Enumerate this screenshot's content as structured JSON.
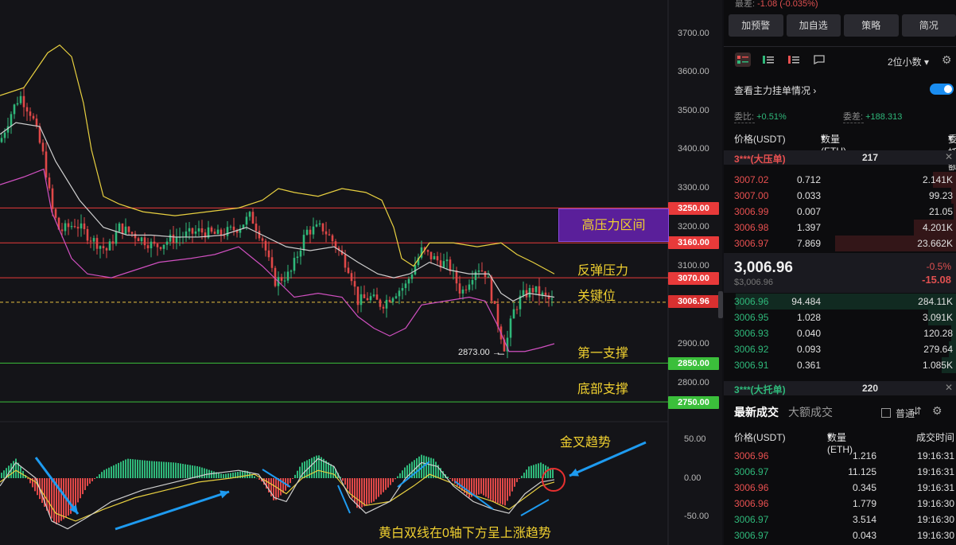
{
  "chart": {
    "price_ticks": [
      "3700.00",
      "3600.00",
      "3500.00",
      "3400.00",
      "3300.00",
      "3200.00",
      "3100.00",
      "2900.00",
      "2800.00"
    ],
    "price_levels": [
      {
        "label": "3250.00",
        "price": 3250,
        "color": "#e83a3a",
        "annotation": "高压力区间"
      },
      {
        "label": "3160.00",
        "price": 3160,
        "color": "#e83a3a",
        "annotation": ""
      },
      {
        "label": "3070.00",
        "price": 3070,
        "color": "#e83a3a",
        "annotation": "反弹压力"
      },
      {
        "label": "3006.96",
        "price": 3006.96,
        "color": "#e83a3a",
        "annotation": "关键位"
      },
      {
        "label": "2850.00",
        "price": 2850,
        "color": "#3bbf3b",
        "annotation": "第一支撑"
      },
      {
        "label": "2750.00",
        "price": 2750,
        "color": "#3bbf3b",
        "annotation": "底部支撑"
      }
    ],
    "annotations": {
      "high_pressure": "高压力区间",
      "rebound_pressure": "反弹压力",
      "key_level": "关键位",
      "first_support": "第一支撑",
      "bottom_support": "底部支撑",
      "golden_cross": "金叉趋势",
      "macd_note": "黄白双线在0轴下方呈上涨趋势"
    },
    "low_marker": "2873.00",
    "macd_ticks": [
      "50.00",
      "0.00",
      "-50.00"
    ],
    "colors": {
      "up": "#2fb87a",
      "down": "#e04848",
      "yellow": "#e8d040",
      "white": "#cfcfcf",
      "magenta": "#d050c0",
      "arrow": "#1e9bf0"
    }
  },
  "panel": {
    "top_info_label": "最差:",
    "top_info_value": "-1.08 (-0.035%)",
    "buttons": [
      "加预警",
      "加自选",
      "策略",
      "简况"
    ],
    "view_icons": [
      "orderbook-both-icon",
      "orderbook-bids-icon",
      "orderbook-asks-icon",
      "expand-icon"
    ],
    "decimals": "2位小数",
    "depth_toggle_label": "查看主力挂单情况",
    "ratio_label": "委比:",
    "ratio_value": "+0.51%",
    "diff_label": "委差:",
    "diff_value": "+188.313",
    "ob_header": {
      "price": "价格(USDT)",
      "qty": "数量 (ETH)",
      "amount": "委托额"
    },
    "big_ask": {
      "label": "3***(大压单)",
      "qty": "217"
    },
    "asks": [
      {
        "price": "3007.02",
        "qty": "0.712",
        "amount": "2.141K",
        "depth": 0.1
      },
      {
        "price": "3007.00",
        "qty": "0.033",
        "amount": "99.23",
        "depth": 0.02
      },
      {
        "price": "3006.99",
        "qty": "0.007",
        "amount": "21.05",
        "depth": 0.01
      },
      {
        "price": "3006.98",
        "qty": "1.397",
        "amount": "4.201K",
        "depth": 0.18
      },
      {
        "price": "3006.97",
        "qty": "7.869",
        "amount": "23.662K",
        "depth": 0.52
      }
    ],
    "last_price": "3,006.96",
    "last_price_usd": "$3,006.96",
    "change_pct": "-0.5%",
    "change_abs": "-15.08",
    "bids": [
      {
        "price": "3006.96",
        "qty": "94.484",
        "amount": "284.11K",
        "depth": 0.95
      },
      {
        "price": "3006.95",
        "qty": "1.028",
        "amount": "3.091K",
        "depth": 0.12
      },
      {
        "price": "3006.93",
        "qty": "0.040",
        "amount": "120.28",
        "depth": 0.02
      },
      {
        "price": "3006.92",
        "qty": "0.093",
        "amount": "279.64",
        "depth": 0.03
      },
      {
        "price": "3006.91",
        "qty": "0.361",
        "amount": "1.085K",
        "depth": 0.06
      }
    ],
    "big_bid": {
      "label": "3***(大托单)",
      "qty": "220"
    },
    "trade_tabs": [
      "最新成交",
      "大额成交"
    ],
    "common_label": "普通",
    "tr_header": {
      "price": "价格(USDT)",
      "qty": "数量(ETH)",
      "time": "成交时间"
    },
    "trades": [
      {
        "price": "3006.96",
        "qty": "1.216",
        "time": "19:16:31",
        "side": "sell"
      },
      {
        "price": "3006.97",
        "qty": "11.125",
        "time": "19:16:31",
        "side": "buy"
      },
      {
        "price": "3006.96",
        "qty": "0.345",
        "time": "19:16:31",
        "side": "sell"
      },
      {
        "price": "3006.96",
        "qty": "1.779",
        "time": "19:16:30",
        "side": "sell"
      },
      {
        "price": "3006.97",
        "qty": "3.514",
        "time": "19:16:30",
        "side": "buy"
      },
      {
        "price": "3006.97",
        "qty": "0.043",
        "time": "19:16:30",
        "side": "buy"
      }
    ]
  }
}
